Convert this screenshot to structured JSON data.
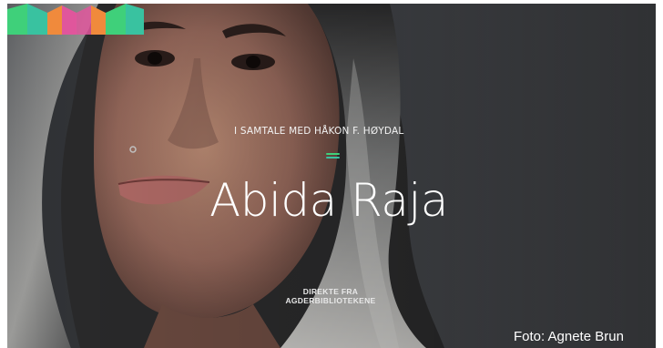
{
  "headline": {
    "kicker": "I SAMTALE MED HÅKON F. HØYDAL",
    "name": "Abida Raja"
  },
  "branding": {
    "line1": "DIREKTE FRA",
    "line2": "AGDERBIBLIOTEKENE"
  },
  "credit": "Foto: Agnete Brun",
  "colors": {
    "accent_green": "#3fd07a",
    "accent_teal": "#39c2a0",
    "accent_pink": "#e0569c",
    "accent_orange": "#f08a3c",
    "text": "#ffffff"
  }
}
